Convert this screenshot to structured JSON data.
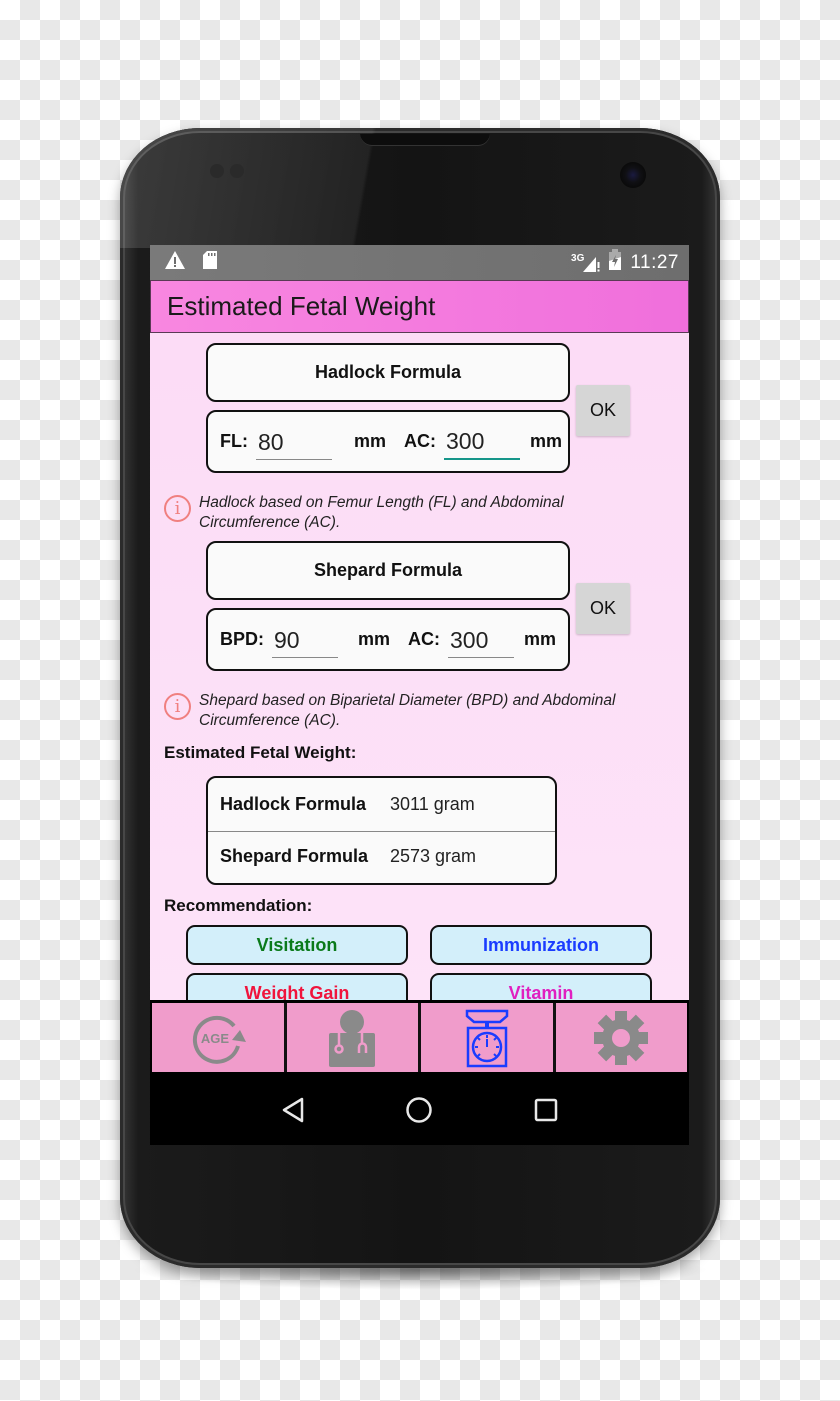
{
  "status_bar": {
    "left_icons": [
      "warning-icon",
      "sd-card-icon"
    ],
    "network": "3G",
    "right_icons": [
      "signal-icon",
      "battery-charging-icon"
    ],
    "time": "11:27"
  },
  "app_bar": {
    "title": "Estimated Fetal Weight"
  },
  "hadlock": {
    "title": "Hadlock Formula",
    "fl_label": "FL:",
    "fl_value": "80",
    "fl_unit": "mm",
    "ac_label": "AC:",
    "ac_value": "300",
    "ac_unit": "mm",
    "ok_label": "OK",
    "info_text": "Hadlock based on Femur Length (FL) and Abdominal Circumference (AC)."
  },
  "shepard": {
    "title": "Shepard Formula",
    "bpd_label": "BPD:",
    "bpd_value": "90",
    "bpd_unit": "mm",
    "ac_label": "AC:",
    "ac_value": "300",
    "ac_unit": "mm",
    "ok_label": "OK",
    "info_text": "Shepard based on Biparietal Diameter (BPD) and Abdominal Circumference (AC)."
  },
  "results": {
    "heading": "Estimated Fetal Weight:",
    "rows": [
      {
        "name": "Hadlock Formula",
        "value": "3011 gram"
      },
      {
        "name": "Shepard Formula",
        "value": "2573 gram"
      }
    ]
  },
  "recommendation": {
    "heading": "Recommendation:",
    "buttons": [
      {
        "label": "Visitation",
        "color": "#0a7a1a"
      },
      {
        "label": "Immunization",
        "color": "#1a3cff"
      },
      {
        "label": "Weight Gain",
        "color": "#f0143c"
      },
      {
        "label": "Vitamin",
        "color": "#e020c0"
      }
    ]
  },
  "bottom_nav": {
    "tabs": [
      {
        "icon": "age-icon",
        "label": "AGE",
        "active": false
      },
      {
        "icon": "doctor-icon",
        "active": false
      },
      {
        "icon": "scale-icon",
        "active": true
      },
      {
        "icon": "gear-icon",
        "active": false
      }
    ],
    "active_color": "#1a3cff",
    "inactive_color": "#8a8a8a"
  },
  "system_nav": {
    "buttons": [
      "back-icon",
      "home-icon",
      "recents-icon"
    ]
  }
}
